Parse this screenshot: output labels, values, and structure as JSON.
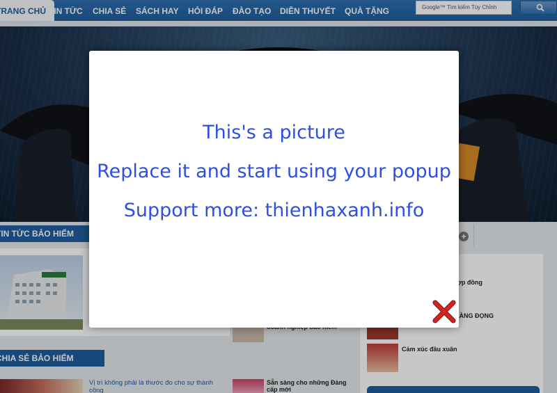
{
  "nav": {
    "items": [
      "TRANG CHỦ",
      "TIN TỨC",
      "CHIA SẺ",
      "SÁCH HAY",
      "HỎI ĐÁP",
      "ĐÀO TẠO",
      "DIỄN THUYẾT",
      "QUÀ TẶNG"
    ],
    "active_index": 0,
    "search_placeholder": "Google™ Tìm kiếm Tùy Chỉnh",
    "search_icon": "search-icon"
  },
  "sections": {
    "tin_tuc": "TIN TỨC BẢO HIỂM",
    "chia_se": "CHIA SẺ BẢO HIỂM"
  },
  "articles": {
    "left_bottom_title": "Vị trí không phải là thước đo cho sự thành công",
    "middle_top_title": "doanh nghiệp bảo hiểm",
    "middle_bottom_title": "Sẵn sàng cho những Đảng cấp mới"
  },
  "sidebar": {
    "items": [
      "hợp đồng",
      "LÀNG ĐỌNG",
      "Cảm xúc đầu xuân"
    ]
  },
  "modal": {
    "line1": "This's a picture",
    "line2": "Replace it and start using your popup",
    "line3": "Support more: thienhaxanh.info",
    "close_icon": "close-icon"
  },
  "colors": {
    "nav": "#1f5e9f",
    "modal_text": "#2f4fe0",
    "close": "#d42323"
  }
}
